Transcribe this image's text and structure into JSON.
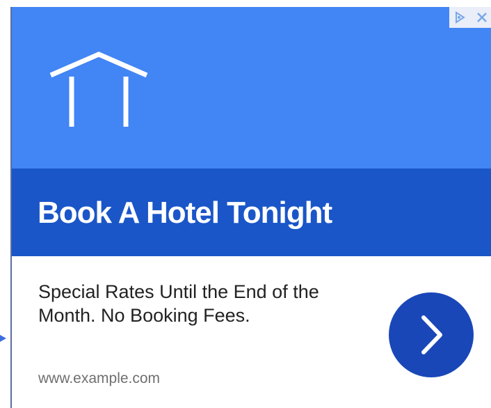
{
  "ad": {
    "headline": "Book A Hotel Tonight",
    "description": "Special Rates Until the End of the Month. No Booking Fees.",
    "display_url": "www.example.com",
    "icons": {
      "hero": "hotel-icon",
      "adchoices": "adchoices-icon",
      "close": "close-icon",
      "cta": "chevron-right-icon"
    },
    "colors": {
      "hero_background": "#4285f4",
      "title_band": "#1a56c8",
      "cta_button": "#1a47b8"
    }
  }
}
